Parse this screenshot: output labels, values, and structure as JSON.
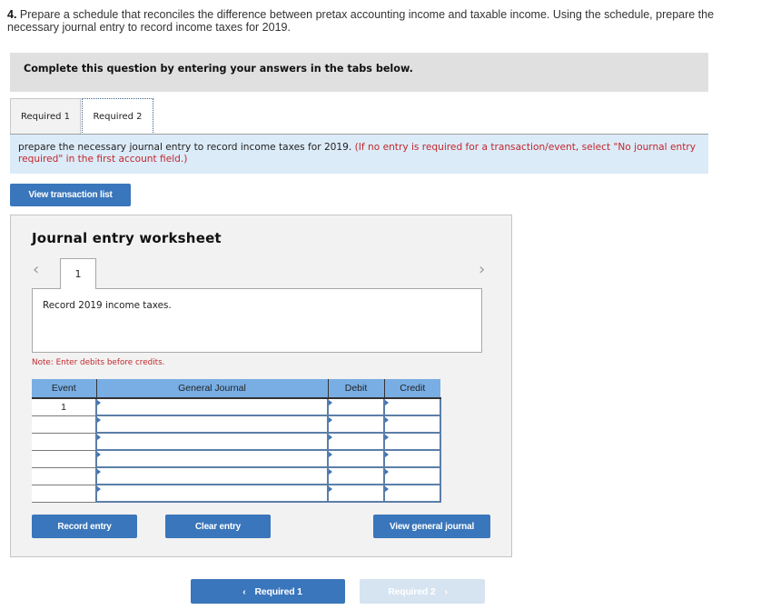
{
  "question": {
    "number": "4.",
    "text": "Prepare a schedule that reconciles the difference between pretax accounting income and taxable income. Using the schedule, prepare the necessary journal entry to record income taxes for 2019."
  },
  "banner": "Complete this question by entering your answers in the tabs below.",
  "tabs": [
    {
      "label": "Required 1",
      "active": false
    },
    {
      "label": "Required 2",
      "active": true
    }
  ],
  "instructions": {
    "main": "prepare the necessary journal entry to record income taxes for 2019. ",
    "note": "(If no entry is required for a transaction/event, select \"No journal entry required\" in the first account field.)"
  },
  "buttons": {
    "view_transaction_list": "View transaction list",
    "record_entry": "Record entry",
    "clear_entry": "Clear entry",
    "view_general_journal": "View general journal"
  },
  "worksheet": {
    "title": "Journal entry worksheet",
    "prev_icon": "chevron-left-icon",
    "next_icon": "chevron-right-icon",
    "current_tab": "1",
    "description": "Record 2019 income taxes.",
    "note": "Note: Enter debits before credits.",
    "table": {
      "headers": [
        "Event",
        "General Journal",
        "Debit",
        "Credit"
      ],
      "rows": [
        {
          "event": "1",
          "account": "",
          "debit": "",
          "credit": ""
        },
        {
          "event": "",
          "account": "",
          "debit": "",
          "credit": ""
        },
        {
          "event": "",
          "account": "",
          "debit": "",
          "credit": ""
        },
        {
          "event": "",
          "account": "",
          "debit": "",
          "credit": ""
        },
        {
          "event": "",
          "account": "",
          "debit": "",
          "credit": ""
        },
        {
          "event": "",
          "account": "",
          "debit": "",
          "credit": ""
        }
      ]
    }
  },
  "nav": {
    "prev_label": "Required 1",
    "next_label": "Required 2",
    "next_disabled": true
  },
  "colors": {
    "button_blue": "#3a76bb",
    "header_blue": "#78aee4",
    "instruction_bg": "#dcebf8",
    "note_red": "#c0282d",
    "disabled_button": "#d6e3f1"
  }
}
